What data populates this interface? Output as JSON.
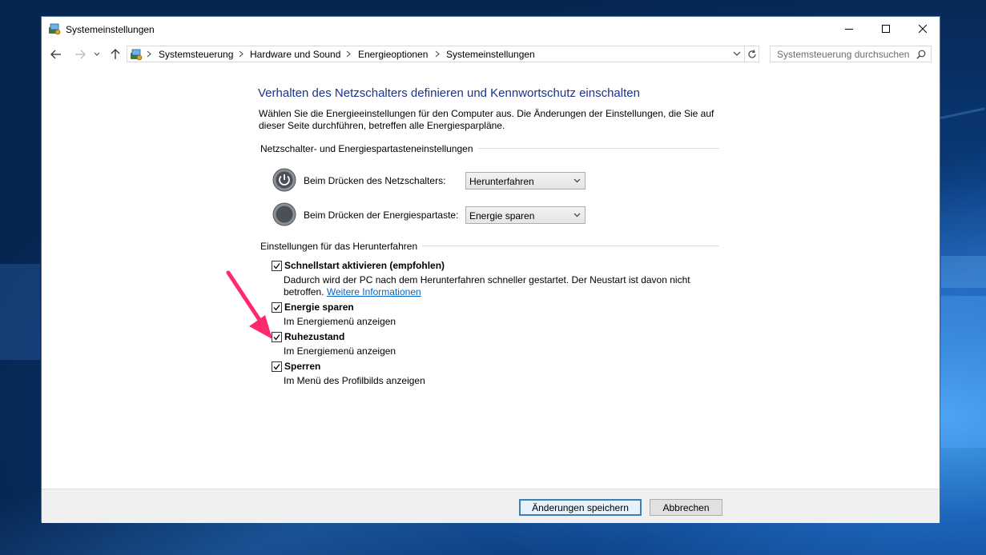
{
  "window": {
    "title": "Systemeinstellungen"
  },
  "navigation": {
    "breadcrumbs": [
      "Systemsteuerung",
      "Hardware und Sound",
      "Energieoptionen",
      "Systemeinstellungen"
    ],
    "search_placeholder": "Systemsteuerung durchsuchen"
  },
  "main": {
    "title": "Verhalten des Netzschalters definieren und Kennwortschutz einschalten",
    "description_line1": "Wählen Sie die Energieeinstellungen für den Computer aus. Die Änderungen der Einstellungen, die Sie auf",
    "description_line2": "dieser Seite durchführen, betreffen alle Energiesparpläne.",
    "power_group": {
      "header": "Netzschalter- und Energiespartasteneinstellungen",
      "rows": [
        {
          "label": "Beim Drücken des Netzschalters:",
          "value": "Herunterfahren"
        },
        {
          "label": "Beim Drücken der Energiespartaste:",
          "value": "Energie sparen"
        }
      ]
    },
    "shutdown_group": {
      "header": "Einstellungen für das Herunterfahren",
      "options": [
        {
          "title": "Schnellstart aktivieren (empfohlen)",
          "desc_line1": "Dadurch wird der PC nach dem Herunterfahren schneller gestartet. Der Neustart ist davon nicht",
          "desc_line2": "betroffen.",
          "link": "Weitere Informationen",
          "checked": true
        },
        {
          "title": "Energie sparen",
          "desc": "Im Energiemenü anzeigen",
          "checked": true
        },
        {
          "title": "Ruhezustand",
          "desc": "Im Energiemenü anzeigen",
          "checked": true
        },
        {
          "title": "Sperren",
          "desc": "Im Menü des Profilbilds anzeigen",
          "checked": true
        }
      ]
    }
  },
  "footer": {
    "save_label": "Änderungen speichern",
    "cancel_label": "Abbrechen"
  },
  "colors": {
    "title_blue": "#1e3287",
    "link_blue": "#0066cc",
    "annotation_arrow": "#ff2a6d"
  }
}
